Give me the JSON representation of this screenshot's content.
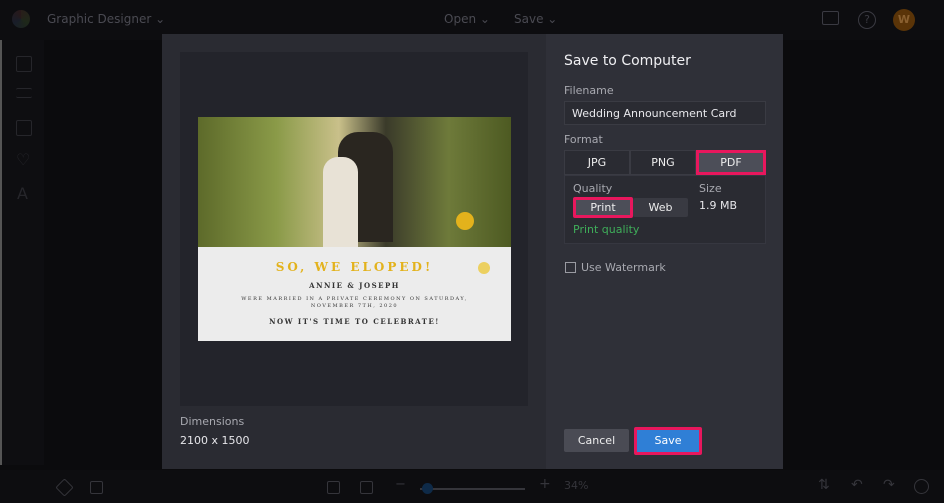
{
  "topbar": {
    "app_name": "Graphic Designer",
    "open_label": "Open",
    "save_label": "Save",
    "avatar_initial": "W"
  },
  "sidebar": {
    "icons": [
      "image-icon",
      "text-icon",
      "grid-icon",
      "heart-icon",
      "font-icon"
    ]
  },
  "bottombar": {
    "zoom": "34%",
    "zoom_fraction": 0.1
  },
  "preview": {
    "card": {
      "title": "SO, WE ELOPED!",
      "names": "ANNIE & JOSEPH",
      "line1": "WERE MARRIED IN A PRIVATE CEREMONY ON SATURDAY,",
      "line2": "NOVEMBER 7TH, 2020",
      "line3": "NOW IT'S TIME TO CELEBRATE!"
    },
    "dimensions_label": "Dimensions",
    "dimensions_value": "2100 x 1500"
  },
  "dialog": {
    "title": "Save to Computer",
    "filename_label": "Filename",
    "filename_value": "Wedding Announcement Card",
    "format_label": "Format",
    "formats": [
      "JPG",
      "PNG",
      "PDF"
    ],
    "selected_format": "PDF",
    "quality_label": "Quality",
    "qualities": [
      "Print",
      "Web"
    ],
    "selected_quality": "Print",
    "quality_note": "Print quality",
    "size_label": "Size",
    "size_value": "1.9 MB",
    "watermark_label": "Use Watermark",
    "watermark_checked": false,
    "cancel_label": "Cancel",
    "save_label": "Save"
  },
  "colors": {
    "highlight": "#e8175d",
    "accent": "#2f7fd6",
    "success": "#3fae5a",
    "gold": "#e3b21c"
  }
}
